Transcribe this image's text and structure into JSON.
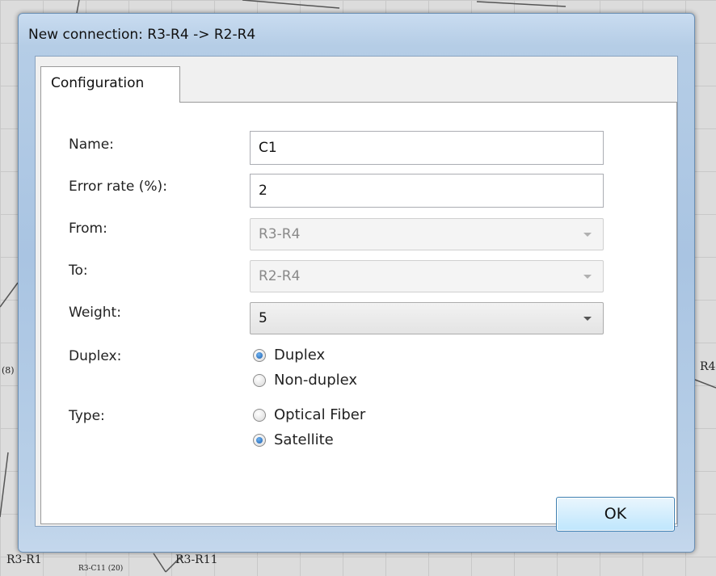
{
  "background": {
    "labels": {
      "left_mid": "(8)",
      "right_mid": "R4",
      "bottom_left": "R3-R1",
      "bottom_small": "R3-C11 (20)",
      "bottom_right": "R3-R11"
    }
  },
  "dialog": {
    "title": "New connection: R3-R4 -> R2-R4",
    "tab_label": "Configuration",
    "fields": {
      "name": {
        "label": "Name:",
        "value": "C1"
      },
      "error_rate": {
        "label": "Error rate (%):",
        "value": "2"
      },
      "from": {
        "label": "From:",
        "value": "R3-R4"
      },
      "to": {
        "label": "To:",
        "value": "R2-R4"
      },
      "weight": {
        "label": "Weight:",
        "value": "5"
      }
    },
    "duplex": {
      "label": "Duplex:",
      "options": [
        "Duplex",
        "Non-duplex"
      ],
      "selected": "Duplex"
    },
    "type": {
      "label": "Type:",
      "options": [
        "Optical Fiber",
        "Satellite"
      ],
      "selected": "Satellite"
    },
    "ok_label": "OK"
  }
}
